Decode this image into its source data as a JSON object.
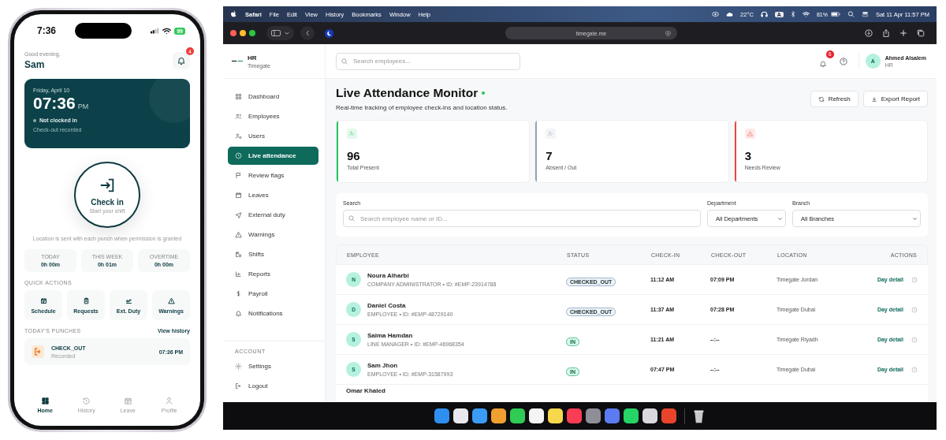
{
  "phone": {
    "status_bar": {
      "time": "7:36",
      "battery": "99"
    },
    "greeting": "Good evening,",
    "user_name": "Sam",
    "notification_badge": "4",
    "clock_card": {
      "date": "Friday, April 10",
      "time": "07:36",
      "period": "PM",
      "status": "Not clocked in",
      "note": "Check-out recorded"
    },
    "check_button": {
      "label": "Check in",
      "sublabel": "Start your shift"
    },
    "location_note": "Location is sent with each punch when permission is granted",
    "stats": [
      {
        "label": "TODAY",
        "value": "0h 00m"
      },
      {
        "label": "THIS WEEK",
        "value": "0h 01m"
      },
      {
        "label": "OVERTIME",
        "value": "0h 00m"
      }
    ],
    "quick_actions_title": "QUICK ACTIONS",
    "quick_actions": [
      {
        "label": "Schedule",
        "kind": "calendar"
      },
      {
        "label": "Requests",
        "kind": "clipboard"
      },
      {
        "label": "Ext. Duty",
        "kind": "plane"
      },
      {
        "label": "Warnings",
        "kind": "warning"
      }
    ],
    "punches_title": "TODAY'S PUNCHES",
    "view_history": "View history",
    "punches": [
      {
        "type": "CHECK_OUT",
        "status": "Recorded",
        "time": "07:36 PM"
      }
    ],
    "tabs": [
      {
        "label": "Home",
        "kind": "grid",
        "selected": true
      },
      {
        "label": "History",
        "kind": "history",
        "selected": false
      },
      {
        "label": "Leave",
        "kind": "calendar",
        "selected": false
      },
      {
        "label": "Profile",
        "kind": "person",
        "selected": false
      }
    ]
  },
  "desktop": {
    "menu_bar": {
      "app_name": "Safari",
      "items": [
        "File",
        "Edit",
        "View",
        "History",
        "Bookmarks",
        "Window",
        "Help"
      ],
      "temperature": "22°C",
      "keyboard": "A",
      "battery": "81%",
      "datetime": "Sat 11 Apr  11:57 PM"
    },
    "browser": {
      "url": "timegate.me"
    },
    "app": {
      "brand": {
        "title": "HR",
        "subtitle": "Timegate"
      },
      "top_search": {
        "placeholder": "Search employees..."
      },
      "notification_badge": "6",
      "user": {
        "initial": "A",
        "name": "Ahmed Alsalem",
        "role": "HR"
      },
      "nav": [
        {
          "label": "Dashboard",
          "kind": "dashboard",
          "selected": false
        },
        {
          "label": "Employees",
          "kind": "employees",
          "selected": false
        },
        {
          "label": "Users",
          "kind": "users",
          "selected": false
        },
        {
          "label": "Live attendance",
          "kind": "live",
          "selected": true
        },
        {
          "label": "Review flags",
          "kind": "flags",
          "selected": false
        },
        {
          "label": "Leaves",
          "kind": "leaves",
          "selected": false
        },
        {
          "label": "External duty",
          "kind": "external",
          "selected": false
        },
        {
          "label": "Warnings",
          "kind": "warnings",
          "selected": false
        },
        {
          "label": "Shifts",
          "kind": "shifts",
          "selected": false
        },
        {
          "label": "Reports",
          "kind": "reports",
          "selected": false
        },
        {
          "label": "Payroll",
          "kind": "payroll",
          "selected": false
        },
        {
          "label": "Notifications",
          "kind": "notifications",
          "selected": false
        }
      ],
      "account_title": "ACCOUNT",
      "account_nav": [
        {
          "label": "Settings",
          "kind": "settings",
          "selected": false
        },
        {
          "label": "Logout",
          "kind": "logout",
          "selected": false
        }
      ],
      "page": {
        "title": "Live Attendance Monitor",
        "live": true,
        "subtitle": "Real-time tracking of employee check-ins and location status.",
        "buttons": [
          {
            "label": "Refresh",
            "kind": "refresh"
          },
          {
            "label": "Export Report",
            "kind": "download"
          }
        ]
      },
      "stat_cards": [
        {
          "value": "96",
          "label": "Total Present",
          "kind": "present",
          "color": "#22c55e"
        },
        {
          "value": "7",
          "label": "Absent / Out",
          "kind": "absent",
          "color": "#94a3b8"
        },
        {
          "value": "3",
          "label": "Needs Review",
          "kind": "review",
          "color": "#ef4444"
        }
      ],
      "filters": {
        "search_label": "Search",
        "search_placeholder": "Search employee name or ID...",
        "department_label": "Department",
        "department": "All Departments",
        "branch_label": "Branch",
        "branch": "All Branches"
      },
      "table": {
        "columns": [
          "EMPLOYEE",
          "STATUS",
          "CHECK-IN",
          "CHECK-OUT",
          "LOCATION",
          "ACTIONS"
        ],
        "rows": [
          {
            "initial": "N",
            "name": "Noura Alharbi",
            "meta": "COMPANY ADMINISTRATOR • ID: #EMP-23914788",
            "status": "CHECKED_OUT",
            "kind": "out",
            "check_in": "11:12 AM",
            "check_out": "07:09 PM",
            "location": "Timegate Jordan",
            "action": "Day detail"
          },
          {
            "initial": "D",
            "name": "Daniel Costa",
            "meta": "EMPLOYEE • ID: #EMP-48729140",
            "status": "CHECKED_OUT",
            "kind": "out",
            "check_in": "11:37 AM",
            "check_out": "07:28 PM",
            "location": "Timegate Dubai",
            "action": "Day detail"
          },
          {
            "initial": "S",
            "name": "Salma Hamdan",
            "meta": "LINE MANAGER • ID: #EMP-46968354",
            "status": "IN",
            "kind": "in",
            "check_in": "11:21 AM",
            "check_out": "--:--",
            "location": "Timegate Riyadh",
            "action": "Day detail"
          },
          {
            "initial": "S",
            "name": "Sam Jhon",
            "meta": "EMPLOYEE • ID: #EMP-31587993",
            "status": "IN",
            "kind": "in",
            "check_in": "07:47 PM",
            "check_out": "--:--",
            "location": "Timegate Dubai",
            "action": "Day detail"
          },
          {
            "name": "Omar Khaled"
          }
        ]
      }
    }
  }
}
